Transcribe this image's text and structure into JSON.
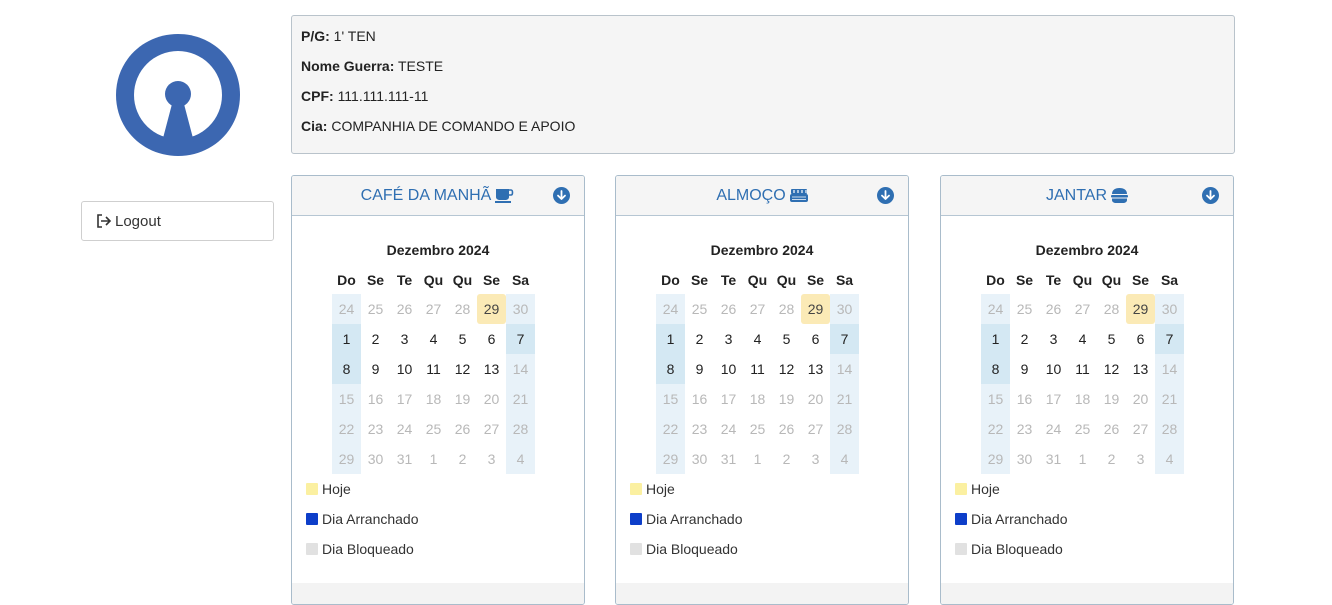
{
  "logout": {
    "label": "Logout"
  },
  "user": {
    "pg_label": "P/G:",
    "pg_value": "1' TEN",
    "nome_label": "Nome Guerra:",
    "nome_value": "TESTE",
    "cpf_label": "CPF:",
    "cpf_value": "111.111.111-11",
    "cia_label": "Cia:",
    "cia_value": "COMPANHIA DE COMANDO E APOIO"
  },
  "calendar": {
    "month_title": "Dezembro 2024",
    "weekdays": [
      "Do",
      "Se",
      "Te",
      "Qu",
      "Qu",
      "Se",
      "Sa"
    ],
    "weeks": [
      [
        "24",
        "25",
        "26",
        "27",
        "28",
        "29",
        "30"
      ],
      [
        "1",
        "2",
        "3",
        "4",
        "5",
        "6",
        "7"
      ],
      [
        "8",
        "9",
        "10",
        "11",
        "12",
        "13",
        "14"
      ],
      [
        "15",
        "16",
        "17",
        "18",
        "19",
        "20",
        "21"
      ],
      [
        "22",
        "23",
        "24",
        "25",
        "26",
        "27",
        "28"
      ],
      [
        "29",
        "30",
        "31",
        "1",
        "2",
        "3",
        "4"
      ]
    ]
  },
  "meals": [
    {
      "title": "CAFÉ DA MANHÃ",
      "icon": "coffee-icon"
    },
    {
      "title": "ALMOÇO",
      "icon": "utensils-icon"
    },
    {
      "title": "JANTAR",
      "icon": "burger-icon"
    }
  ],
  "legend": {
    "hoje": "Hoje",
    "arranchado": "Dia Arranchado",
    "bloqueado": "Dia Bloqueado"
  },
  "colors": {
    "accent": "#2f6fb2",
    "logo": "#3c67b1",
    "hoje": "#fbf0a1",
    "arranchado": "#0d3ec9",
    "bloqueado": "#e1e1e1"
  }
}
